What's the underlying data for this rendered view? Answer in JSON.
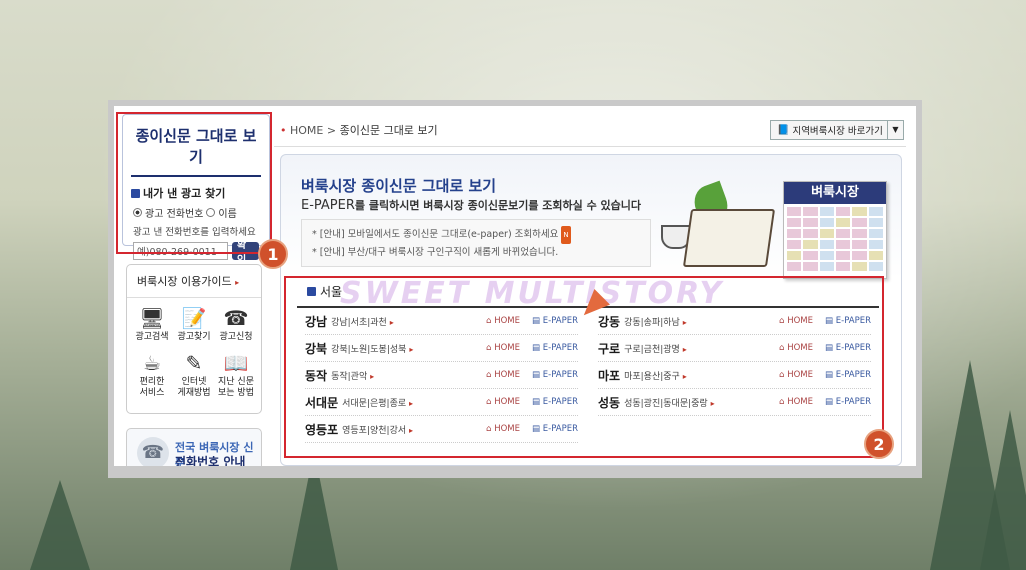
{
  "left": {
    "title": "종이신문 그대로 보기",
    "my_ad": "내가 낸 광고 찾기",
    "radio_phone": "광고 전화번호",
    "radio_name": "이름",
    "help": "광고 낸 전화번호를 입력하세요",
    "input_value": "예)080-269-0011",
    "confirm": "확인"
  },
  "guide": {
    "title": "벼룩시장 이용가이드",
    "items": [
      {
        "icon": "🖥",
        "label": "광고검색"
      },
      {
        "icon": "📝",
        "label": "광고찾기"
      },
      {
        "icon": "☎",
        "label": "광고신청"
      },
      {
        "icon": "☕",
        "label": "편리한\n서비스"
      },
      {
        "icon": "✎",
        "label": "인터넷\n게재방법"
      },
      {
        "icon": "📖",
        "label": "지난 신문\n보는 방법"
      }
    ]
  },
  "phone": {
    "line1": "전국 벼룩시장 신문",
    "line2": "전화번호 안내"
  },
  "breadcrumb": {
    "home": "HOME",
    "sep": ">",
    "current": "종이신문 그대로 보기"
  },
  "region_dropdown": "지역벼룩시장 바로가기",
  "main": {
    "title": "벼룩시장 종이신문 그대로 보기",
    "sub_strong": "E-PAPER",
    "sub_rest": "를 클릭하시면 벼룩시장 종이신문보기를 조회하실 수 있습니다",
    "notice1": "* [안내] 모바일에서도 종이신문 그대로(e-paper) 조회하세요",
    "notice2": "* [안내] 부산/대구 벼룩시장 구인구직이 새롭게 바뀌었습니다.",
    "paper_title": "벼룩시장"
  },
  "section": {
    "title": "서울",
    "home_label": "HOME",
    "epaper_label": "E-PAPER",
    "rows": [
      {
        "name": "강남",
        "sub": "강남|서초|과천"
      },
      {
        "name": "강동",
        "sub": "강동|송파|하남"
      },
      {
        "name": "강북",
        "sub": "강북|노원|도봉|성북"
      },
      {
        "name": "구로",
        "sub": "구로|금천|광명"
      },
      {
        "name": "동작",
        "sub": "동작|관악"
      },
      {
        "name": "마포",
        "sub": "마포|용산|중구"
      },
      {
        "name": "서대문",
        "sub": "서대문|은평|종로"
      },
      {
        "name": "성동",
        "sub": "성동|광진|동대문|중랑"
      },
      {
        "name": "영등포",
        "sub": "영등포|양천|강서"
      }
    ]
  },
  "callouts": {
    "one": "1",
    "two": "2"
  },
  "watermark": "SWEET MULTISTORY",
  "colors": {
    "accent": "#24418c",
    "highlight": "#d4262f",
    "badge": "#d0512b"
  }
}
